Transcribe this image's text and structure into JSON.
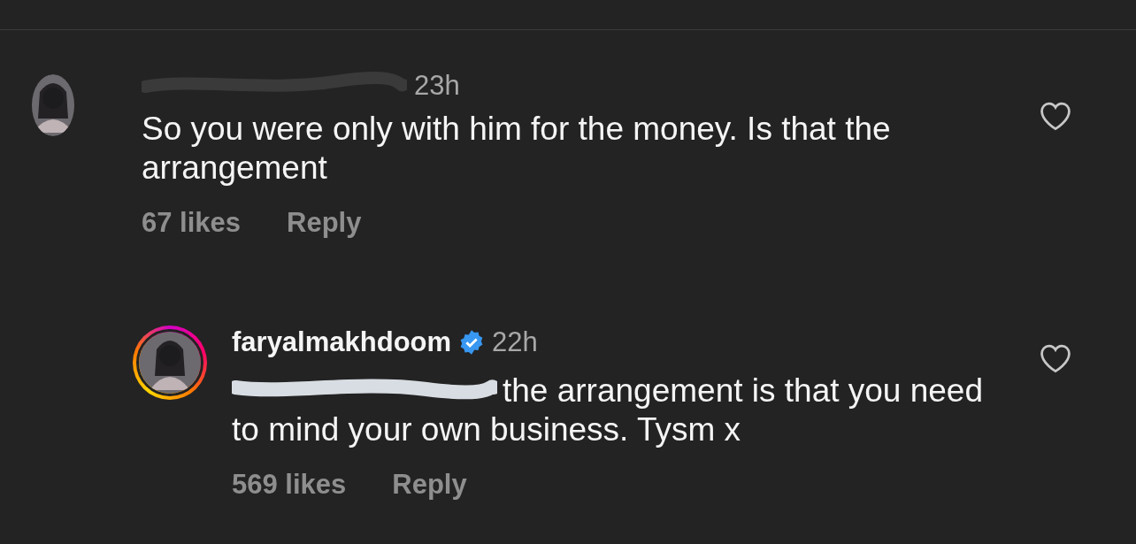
{
  "comments": [
    {
      "kind": "comment",
      "username_redacted": true,
      "time": "23h",
      "text": "So you were only with him for the money. Is that the arrangement",
      "likes": "67 likes",
      "reply_label": "Reply",
      "liked": false
    },
    {
      "kind": "reply",
      "username": "faryalmakhdoom",
      "verified": true,
      "story_ring": true,
      "time": "22h",
      "mention_redacted": true,
      "text": "the arrangement is that you need to mind your own business. Tysm x",
      "likes": "569 likes",
      "reply_label": "Reply",
      "liked": false
    }
  ]
}
